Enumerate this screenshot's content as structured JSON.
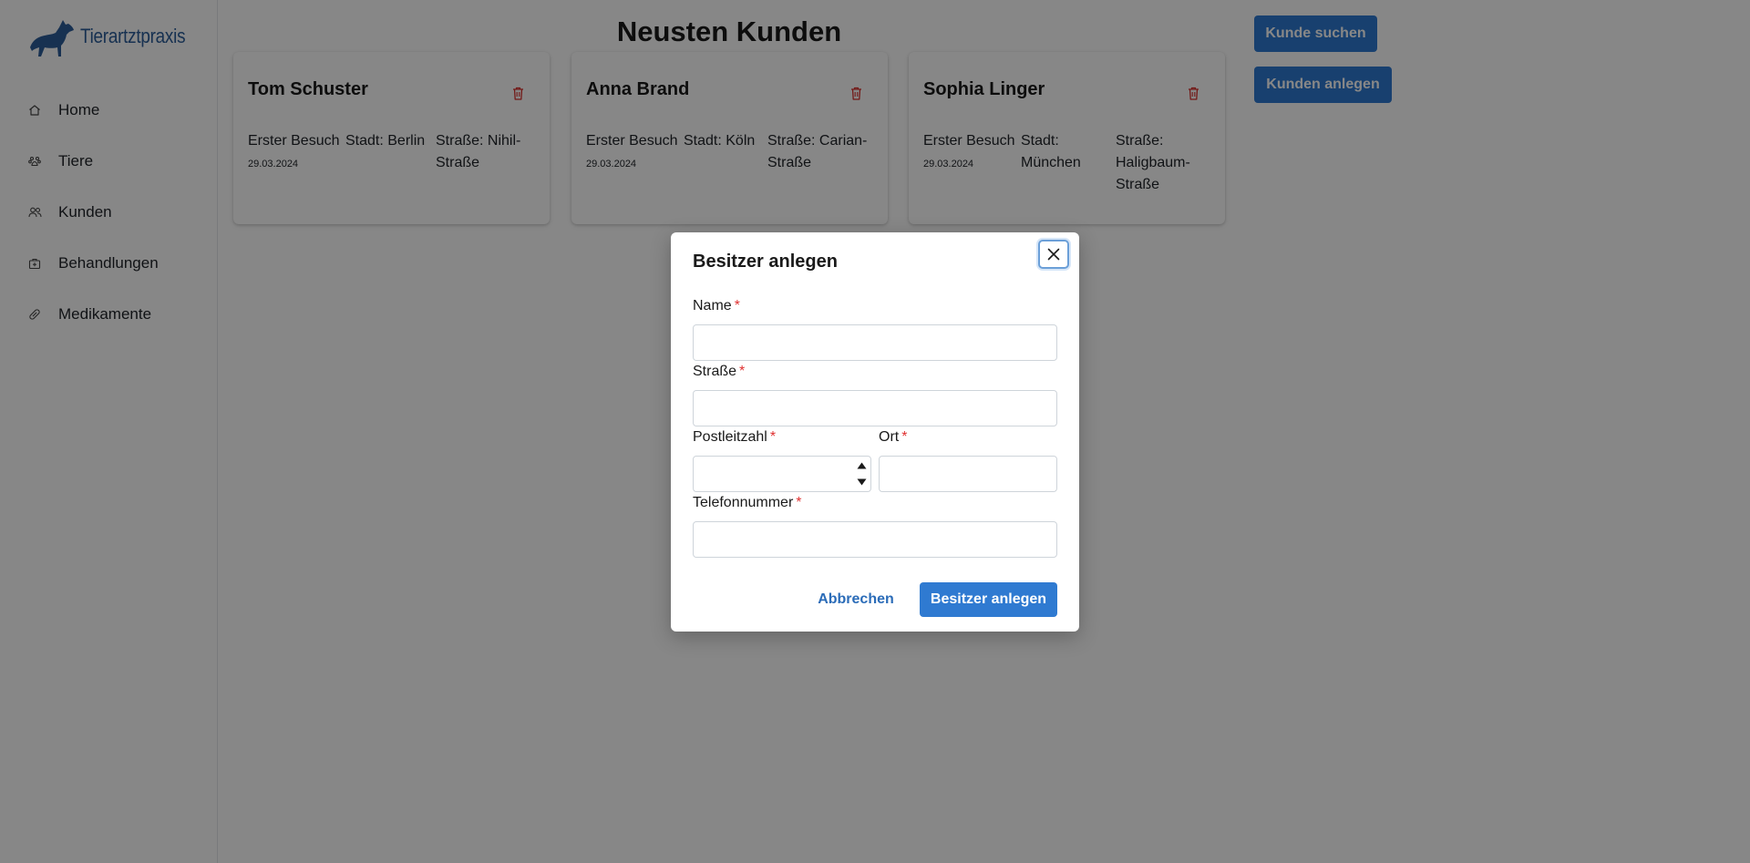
{
  "app": {
    "brand": "Tierartztpraxis"
  },
  "sidebar": {
    "items": [
      {
        "label": "Home",
        "icon": "home-icon"
      },
      {
        "label": "Tiere",
        "icon": "paw-icon"
      },
      {
        "label": "Kunden",
        "icon": "users-icon"
      },
      {
        "label": "Behandlungen",
        "icon": "medical-bag-icon"
      },
      {
        "label": "Medikamente",
        "icon": "pill-icon"
      }
    ]
  },
  "main": {
    "title": "Neusten Kunden",
    "search_button": "Kunde suchen",
    "create_button": "Kunden anlegen",
    "customers": [
      {
        "name": "Tom Schuster",
        "first_visit_label": "Erster Besuch",
        "first_visit": "29.03.2024",
        "city": "Stadt: Berlin",
        "street": "Straße: Nihil-Straße"
      },
      {
        "name": "Anna Brand",
        "first_visit_label": "Erster Besuch",
        "first_visit": "29.03.2024",
        "city": "Stadt: Köln",
        "street": "Straße: Carian-Straße"
      },
      {
        "name": "Sophia Linger",
        "first_visit_label": "Erster Besuch",
        "first_visit": "29.03.2024",
        "city": "Stadt: München",
        "street": "Straße: Haligbaum-Straße"
      }
    ]
  },
  "modal": {
    "title": "Besitzer anlegen",
    "required_marker": "*",
    "fields": {
      "name": {
        "label": "Name",
        "value": ""
      },
      "street": {
        "label": "Straße",
        "value": ""
      },
      "zip": {
        "label": "Postleitzahl",
        "value": ""
      },
      "city": {
        "label": "Ort",
        "value": ""
      },
      "phone": {
        "label": "Telefonnummer",
        "value": ""
      }
    },
    "cancel_button": "Abbrechen",
    "submit_button": "Besitzer anlegen"
  },
  "colors": {
    "primary": "#2f7ad1",
    "brand": "#2c5e99",
    "required": "#e03131",
    "delete": "#d9302c"
  }
}
